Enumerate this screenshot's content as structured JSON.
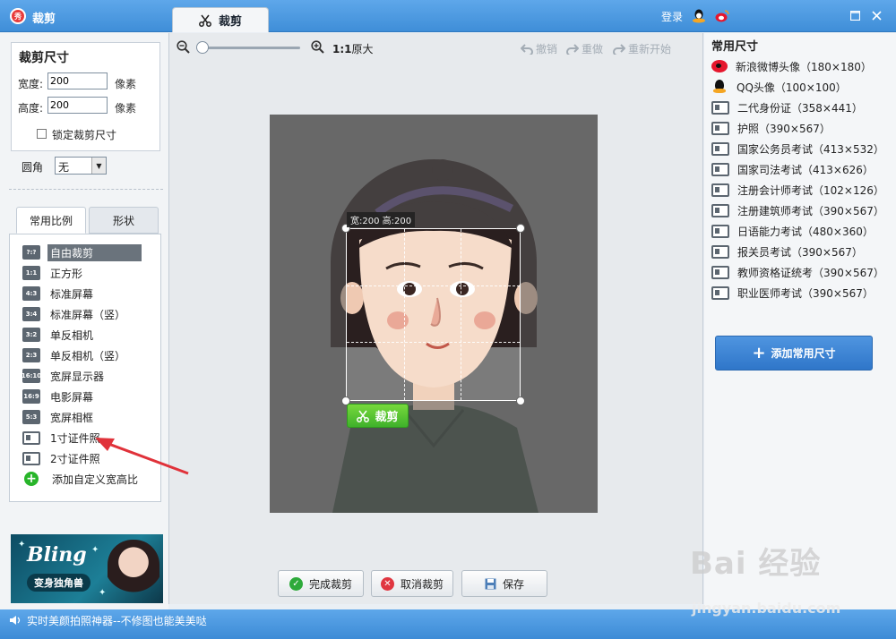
{
  "app": {
    "title": "裁剪",
    "logo_text": "秀",
    "active_tab": "裁剪",
    "login_label": "登录"
  },
  "crop_size": {
    "title": "裁剪尺寸",
    "width_label": "宽度:",
    "width_value": "200",
    "height_label": "高度:",
    "height_value": "200",
    "unit": "像素",
    "lock_label": "锁定裁剪尺寸",
    "lock_checked": false
  },
  "corner": {
    "label": "圆角",
    "value": "无"
  },
  "side_tabs": [
    "常用比例",
    "形状"
  ],
  "ratio_items": [
    {
      "badge": "?:?",
      "label": "自由裁剪",
      "selected": true
    },
    {
      "badge": "1:1",
      "label": "正方形"
    },
    {
      "badge": "4:3",
      "label": "标准屏幕"
    },
    {
      "badge": "3:4",
      "label": "标准屏幕（竖）"
    },
    {
      "badge": "3:2",
      "label": "单反相机"
    },
    {
      "badge": "2:3",
      "label": "单反相机（竖）"
    },
    {
      "badge": "16:10",
      "label": "宽屏显示器"
    },
    {
      "badge": "16:9",
      "label": "电影屏幕"
    },
    {
      "badge": "5:3",
      "label": "宽屏相框"
    },
    {
      "icon": "id-card-icon",
      "label": "1寸证件照"
    },
    {
      "icon": "id-card-icon",
      "label": "2寸证件照"
    },
    {
      "icon": "plus-icon",
      "label": "添加自定义宽高比"
    }
  ],
  "banner": {
    "title": "Bling",
    "subtitle": "变身独角兽"
  },
  "toolbar": {
    "ratio_prefix": "1:1",
    "ratio_label": "原大",
    "undo": "撤销",
    "redo": "重做",
    "restart": "重新开始",
    "zoom_level": 0
  },
  "crop": {
    "size_tag": "宽:200 高:200",
    "button_label": "裁剪"
  },
  "actions": {
    "finish": "完成裁剪",
    "cancel": "取消裁剪",
    "save": "保存"
  },
  "presets": {
    "title": "常用尺寸",
    "items": [
      {
        "icon": "weibo-icon",
        "label": "新浪微博头像（180×180）"
      },
      {
        "icon": "qq-icon",
        "label": "QQ头像（100×100）"
      },
      {
        "icon": "id-card-icon",
        "label": "二代身份证（358×441）"
      },
      {
        "icon": "id-card-icon",
        "label": "护照（390×567）"
      },
      {
        "icon": "id-card-icon",
        "label": "国家公务员考试（413×532）"
      },
      {
        "icon": "id-card-icon",
        "label": "国家司法考试（413×626）"
      },
      {
        "icon": "id-card-icon",
        "label": "注册会计师考试（102×126）"
      },
      {
        "icon": "id-card-icon",
        "label": "注册建筑师考试（390×567）"
      },
      {
        "icon": "id-card-icon",
        "label": "日语能力考试（480×360）"
      },
      {
        "icon": "id-card-icon",
        "label": "报关员考试（390×567）"
      },
      {
        "icon": "id-card-icon",
        "label": "教师资格证统考（390×567）"
      },
      {
        "icon": "id-card-icon",
        "label": "职业医师考试（390×567）"
      }
    ],
    "add_button": "添加常用尺寸"
  },
  "status": {
    "text": "实时美颜拍照神器--不修图也能美美哒"
  },
  "watermark": {
    "text": "Bai 经验",
    "url": "jingyan.baidu.com"
  },
  "colors": {
    "title_bar": "#4a98e0",
    "crop_button": "#4fbf2f",
    "add_button": "#3a82d2",
    "arrow": "#e0323a"
  }
}
